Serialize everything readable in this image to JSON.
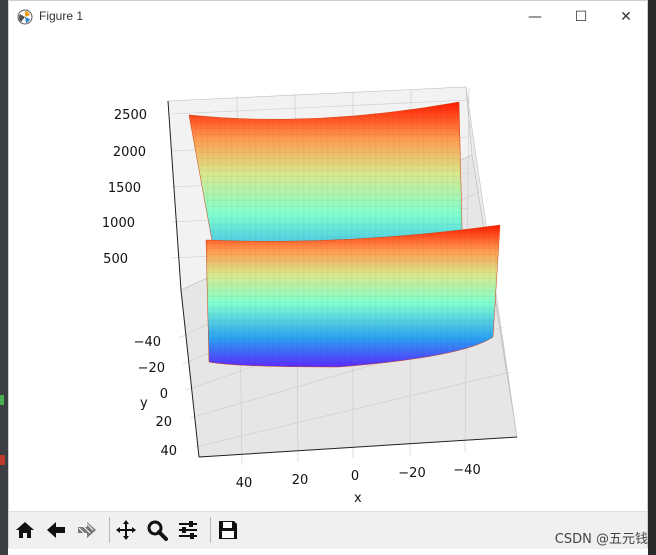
{
  "window": {
    "title": "Figure 1",
    "minimize_glyph": "—",
    "maximize_glyph": "☐",
    "close_glyph": "✕"
  },
  "toolbar": {
    "buttons": [
      "home-icon",
      "back-arrow-icon",
      "forward-arrow-icon",
      "pan-move-icon",
      "zoom-magnifier-icon",
      "configure-subplots-icon",
      "save-disk-icon"
    ]
  },
  "watermark": "CSDN @五元钱",
  "chart_data": {
    "type": "surface3d",
    "title": "",
    "xlabel": "x",
    "ylabel": "y",
    "zlabel": "",
    "colormap": "rainbow",
    "x_range": [
      -50,
      50
    ],
    "y_range": [
      -50,
      50
    ],
    "z_range": [
      0,
      2500
    ],
    "x_ticks": [
      "40",
      "20",
      "0",
      "−20",
      "−40"
    ],
    "y_ticks": [
      "−40",
      "−20",
      "0",
      "20",
      "40"
    ],
    "z_ticks": [
      "500",
      "1000",
      "1500",
      "2000",
      "2500"
    ],
    "grid": true,
    "surface_formula": "z = x^2 (paraboloid rising along x, flat along y)"
  }
}
